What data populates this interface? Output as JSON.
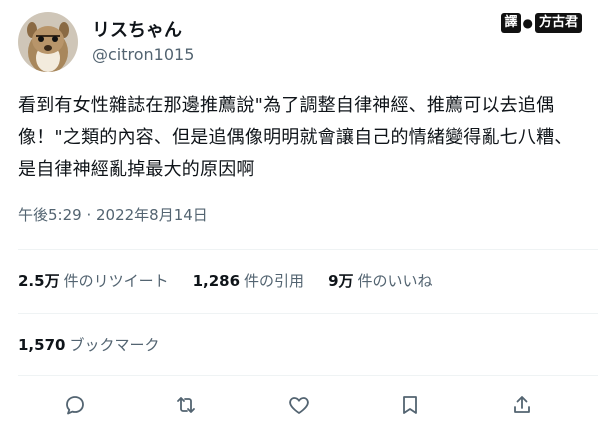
{
  "user": {
    "display_name": "リスちゃん",
    "handle": "@citron1015"
  },
  "badge": {
    "left": "譯",
    "dot": "●",
    "right": "方古君"
  },
  "tweet": {
    "text": "看到有女性雜誌在那邊推薦說\"為了調整自律神經、推薦可以去追偶像！\"之類的內容、但是追偶像明明就會讓自己的情緒變得亂七八糟、是自律神經亂掉最大的原因啊",
    "timestamp": "午後5:29 · 2022年8月14日"
  },
  "stats": {
    "retweets_num": "2.5万",
    "retweets_label": "件のリツイート",
    "quotes_num": "1,286",
    "quotes_label": "件の引用",
    "likes_num": "9万",
    "likes_label": "件のいいね",
    "bookmarks_num": "1,570",
    "bookmarks_label": "ブックマーク"
  },
  "actions": [
    "reply-icon",
    "retweet-icon",
    "like-icon",
    "bookmark-icon",
    "share-icon"
  ],
  "colors": {
    "text": "#0f1419",
    "secondary": "#536471",
    "divider": "#eff3f4"
  }
}
